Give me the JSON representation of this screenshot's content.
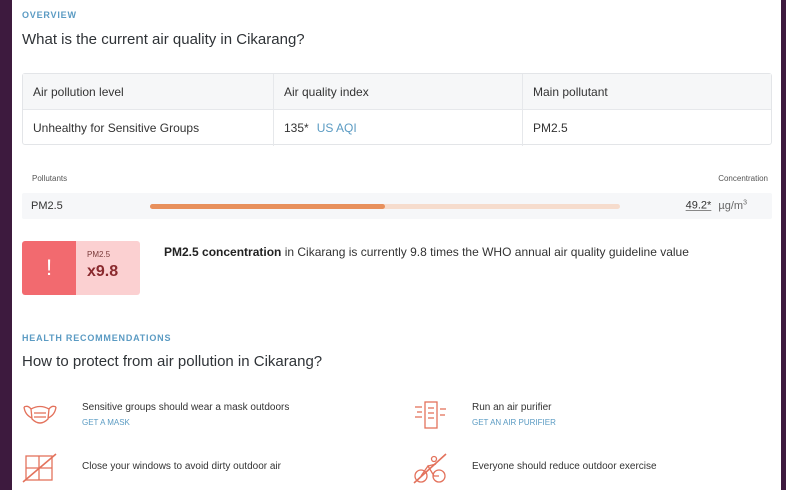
{
  "overview": {
    "eyebrow": "OVERVIEW",
    "title": "What is the current air quality in Cikarang?"
  },
  "summary": {
    "headers": [
      "Air pollution level",
      "Air quality index",
      "Main pollutant"
    ],
    "level": "Unhealthy for Sensitive Groups",
    "aqi_value": "135*",
    "aqi_unit": "US AQI",
    "main_pollutant": "PM2.5"
  },
  "pollutants": {
    "label": "Pollutants",
    "concentration_label": "Concentration",
    "items": [
      {
        "name": "PM2.5",
        "value": "49.2*",
        "unit": "µg/m",
        "unit_sup": "3",
        "bar_fraction": 0.5
      }
    ]
  },
  "warning": {
    "icon": "exclamation-icon",
    "pollutant": "PM2.5",
    "multiplier": "x9.8",
    "text_bold": "PM2.5 concentration",
    "text_rest": " in Cikarang is currently 9.8 times the WHO annual air quality guideline value"
  },
  "health": {
    "eyebrow": "HEALTH RECOMMENDATIONS",
    "title": "How to protect from air pollution in Cikarang?",
    "items": [
      {
        "icon": "mask-icon",
        "text": "Sensitive groups should wear a mask outdoors",
        "link": "GET A MASK"
      },
      {
        "icon": "air-purifier-icon",
        "text": "Run an air purifier",
        "link": "GET AN AIR PURIFIER"
      },
      {
        "icon": "closed-window-icon",
        "text": "Close your windows to avoid dirty outdoor air",
        "link": ""
      },
      {
        "icon": "no-cycling-icon",
        "text": "Everyone should reduce outdoor exercise",
        "link": ""
      }
    ]
  },
  "colors": {
    "accent": "#5b9bc3",
    "bar_fill": "#e8905c",
    "bar_track": "#f6dccd",
    "warning": "#f26a6f",
    "warning_light": "#fbd0d1",
    "icon_stroke": "#e3725c"
  }
}
